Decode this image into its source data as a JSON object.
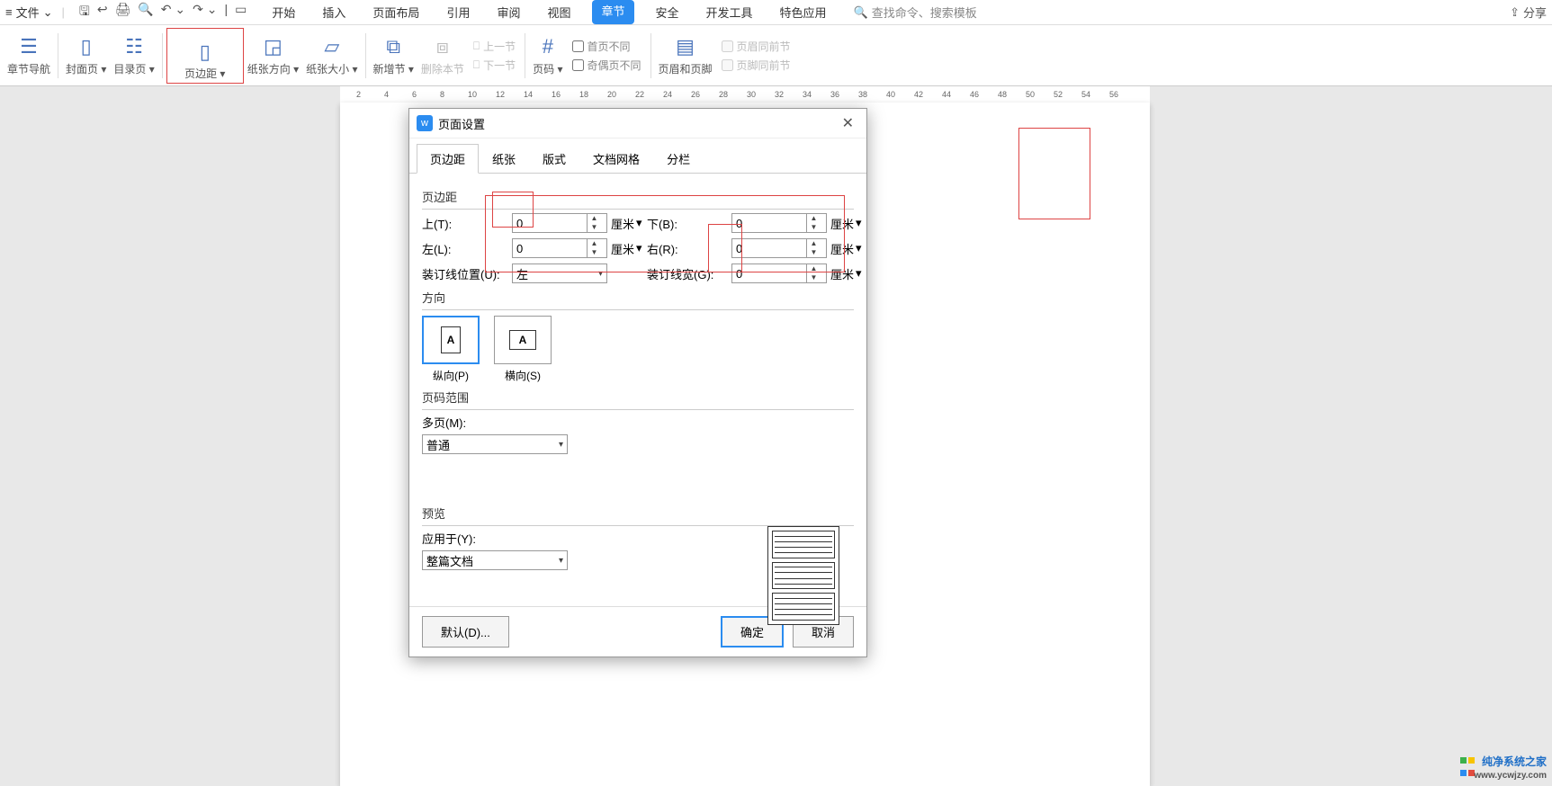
{
  "menubar": {
    "file": "文件",
    "qat_icons": [
      "save-icon",
      "open-icon",
      "print-icon",
      "print-preview-icon",
      "undo-icon",
      "redo-icon"
    ],
    "tabs": [
      "开始",
      "插入",
      "页面布局",
      "引用",
      "审阅",
      "视图",
      "章节",
      "安全",
      "开发工具",
      "特色应用"
    ],
    "active_tab_index": 6,
    "search_placeholder": "查找命令、搜索模板",
    "share": "分享"
  },
  "ribbon": {
    "buttons": [
      {
        "label": "章节导航",
        "icon": "nav-icon"
      },
      {
        "label": "封面页",
        "icon": "cover-icon",
        "dropdown": true
      },
      {
        "label": "目录页",
        "icon": "toc-icon",
        "dropdown": true
      },
      {
        "label": "页边距",
        "icon": "margin-icon",
        "dropdown": true,
        "highlight": true
      },
      {
        "label": "纸张方向",
        "icon": "orientation-icon",
        "dropdown": true
      },
      {
        "label": "纸张大小",
        "icon": "size-icon",
        "dropdown": true
      },
      {
        "label": "新增节",
        "icon": "section-add-icon",
        "dropdown": true
      },
      {
        "label": "删除本节",
        "icon": "section-del-icon",
        "disabled": true
      }
    ],
    "section_small": {
      "prev": "上一节",
      "next": "下一节"
    },
    "page_number": {
      "label": "页码",
      "dropdown": true
    },
    "header_footer_checks": {
      "first_diff": "首页不同",
      "odd_even_diff": "奇偶页不同"
    },
    "header_footer_btn": "页眉和页脚",
    "header_footer_same": {
      "header_same": "页眉同前节",
      "footer_same": "页脚同前节"
    }
  },
  "ruler_numbers": [
    "2",
    "4",
    "6",
    "8",
    "10",
    "12",
    "14",
    "16",
    "18",
    "20",
    "22",
    "24",
    "26",
    "28",
    "30",
    "32",
    "34",
    "36",
    "38",
    "40",
    "42",
    "44",
    "46",
    "48",
    "50",
    "52",
    "54",
    "56"
  ],
  "dialog": {
    "title": "页面设置",
    "tabs": [
      "页边距",
      "纸张",
      "版式",
      "文档网格",
      "分栏"
    ],
    "active_tab_index": 0,
    "margins_section": "页边距",
    "top_label": "上(T):",
    "top_value": "0",
    "top_unit": "厘米",
    "bottom_label": "下(B):",
    "bottom_value": "0",
    "bottom_unit": "厘米",
    "left_label": "左(L):",
    "left_value": "0",
    "left_unit": "厘米",
    "right_label": "右(R):",
    "right_value": "0",
    "right_unit": "厘米",
    "gutter_pos_label": "装订线位置(U):",
    "gutter_pos_value": "左",
    "gutter_width_label": "装订线宽(G):",
    "gutter_width_value": "0",
    "gutter_unit": "厘米",
    "orientation_section": "方向",
    "portrait": "纵向(P)",
    "landscape": "横向(S)",
    "page_range_section": "页码范围",
    "multi_page_label": "多页(M):",
    "multi_page_value": "普通",
    "preview_section": "预览",
    "apply_to_label": "应用于(Y):",
    "apply_to_value": "整篇文档",
    "default_btn": "默认(D)...",
    "ok_btn": "确定",
    "cancel_btn": "取消"
  },
  "watermark": {
    "name": "纯净系统之家",
    "url": "www.ycwjzy.com"
  }
}
